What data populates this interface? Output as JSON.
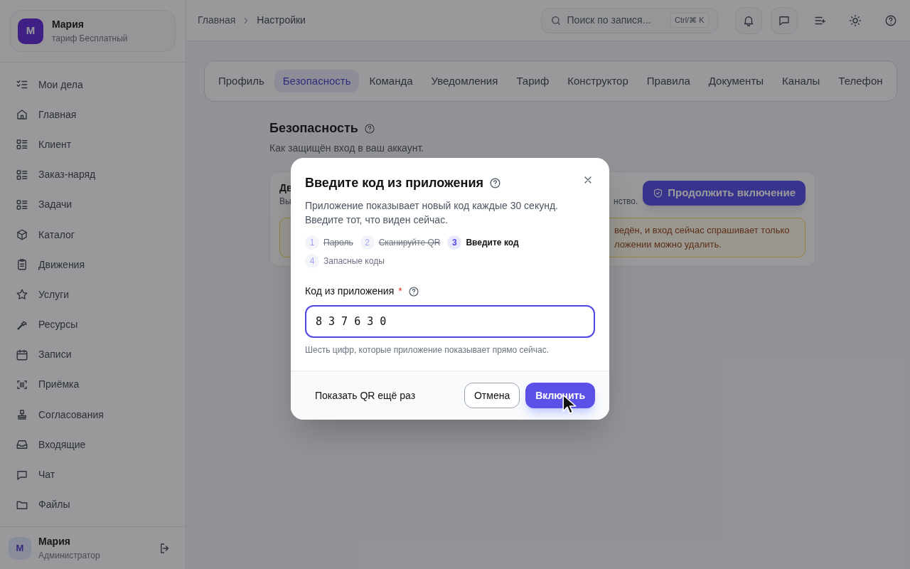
{
  "sidebar": {
    "account": {
      "avatar": "М",
      "name": "Мария",
      "plan": "тариф Бесплатный"
    },
    "items": [
      {
        "label": "Мои дела",
        "selected": false
      },
      {
        "label": "Главная",
        "selected": false
      },
      {
        "label": "Клиент",
        "selected": false
      },
      {
        "label": "Заказ-наряд",
        "selected": false
      },
      {
        "label": "Задачи",
        "selected": false
      },
      {
        "label": "Каталог",
        "selected": false
      },
      {
        "label": "Движения",
        "selected": false
      },
      {
        "label": "Услуги",
        "selected": false
      },
      {
        "label": "Ресурсы",
        "selected": false
      },
      {
        "label": "Записи",
        "selected": false
      },
      {
        "label": "Приёмка",
        "selected": false
      },
      {
        "label": "Согласования",
        "selected": false
      },
      {
        "label": "Входящие",
        "selected": false
      },
      {
        "label": "Чат",
        "selected": false
      },
      {
        "label": "Файлы",
        "selected": false
      }
    ],
    "user": {
      "avatar": "М",
      "name": "Мария",
      "role": "Администратор"
    }
  },
  "header": {
    "breadcrumb": [
      "Главная",
      "Настройки"
    ],
    "search": {
      "placeholder": "Поиск по запися...",
      "shortcut": "Ctrl/⌘ K"
    }
  },
  "tabs": [
    {
      "label": "Профиль",
      "selected": false
    },
    {
      "label": "Безопасность",
      "selected": true
    },
    {
      "label": "Команда",
      "selected": false
    },
    {
      "label": "Уведомления",
      "selected": false
    },
    {
      "label": "Тариф",
      "selected": false
    },
    {
      "label": "Конструктор",
      "selected": false
    },
    {
      "label": "Правила",
      "selected": false
    },
    {
      "label": "Документы",
      "selected": false
    },
    {
      "label": "Каналы",
      "selected": false
    },
    {
      "label": "Телефон",
      "selected": false
    }
  ],
  "section": {
    "title": "Безопасность",
    "subtitle": "Как защищён вход в ваш аккаунт.",
    "card": {
      "title_start": "Дв",
      "text_start": "Вы",
      "text_end": "нство.",
      "button": "Продолжить включение",
      "warning_lines": [
        "ведён, и вход сейчас спрашивает только",
        "ложении можно удалить."
      ]
    }
  },
  "dialog": {
    "title": "Введите код из приложения",
    "description": "Приложение показывает новый код каждые 30 секунд. Введите тот, что виден сейчас.",
    "steps": [
      {
        "number": "1",
        "label": "Пароль",
        "done": true,
        "selected": false
      },
      {
        "number": "2",
        "label": "Сканируйте QR",
        "done": true,
        "selected": false
      },
      {
        "number": "3",
        "label": "Введите код",
        "done": false,
        "selected": true
      },
      {
        "number": "4",
        "label": "Запасные коды",
        "done": false,
        "selected": false
      }
    ],
    "field": {
      "label": "Код из приложения",
      "required_mark": "*",
      "value": "8 3 7 6 3 0",
      "hint": "Шесть цифр, которые приложение показывает прямо сейчас."
    },
    "buttons": [
      {
        "kind": "link",
        "label": "Показать QR ещё раз"
      },
      {
        "kind": "outline",
        "label": "Отмена"
      },
      {
        "kind": "primary",
        "label": "Включить"
      }
    ]
  }
}
